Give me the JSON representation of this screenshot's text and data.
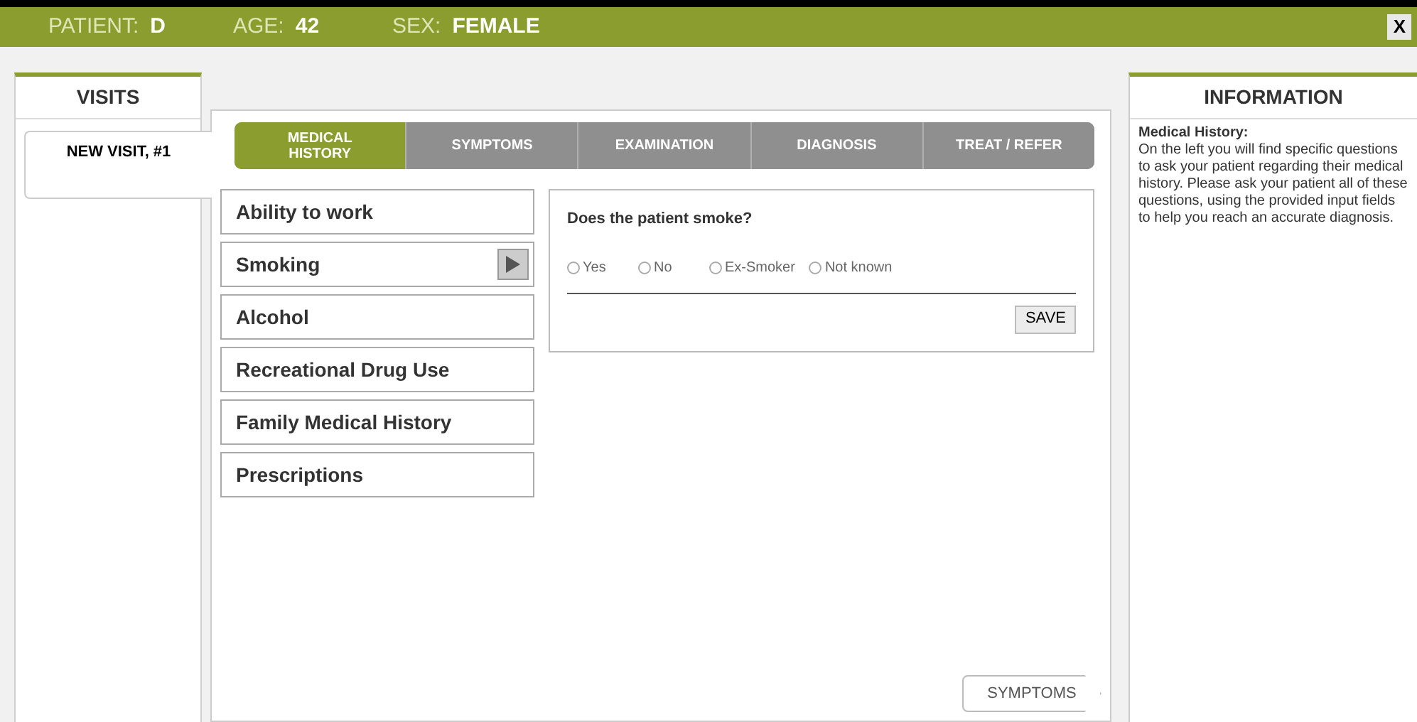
{
  "header": {
    "fields": [
      {
        "label": "PATIENT:",
        "value": "D"
      },
      {
        "label": "AGE:",
        "value": "42"
      },
      {
        "label": "SEX:",
        "value": "FEMALE"
      }
    ],
    "close": "X"
  },
  "visits": {
    "title": "VISITS",
    "items": [
      {
        "label": "NEW VISIT, #1",
        "selected": true
      }
    ]
  },
  "steps": [
    {
      "label": "MEDICAL HISTORY",
      "selected": true
    },
    {
      "label": "SYMPTOMS",
      "selected": false
    },
    {
      "label": "EXAMINATION",
      "selected": false
    },
    {
      "label": "DIAGNOSIS",
      "selected": false
    },
    {
      "label": "TREAT / REFER",
      "selected": false
    }
  ],
  "questions": [
    {
      "label": "Ability to work",
      "selected": false
    },
    {
      "label": "Smoking",
      "selected": true
    },
    {
      "label": "Alcohol",
      "selected": false
    },
    {
      "label": "Recreational Drug Use",
      "selected": false
    },
    {
      "label": "Family Medical History",
      "selected": false
    },
    {
      "label": "Prescriptions",
      "selected": false
    }
  ],
  "form": {
    "question": "Does the patient smoke?",
    "options": [
      {
        "label": "Yes",
        "selected": false
      },
      {
        "label": "No",
        "selected": false
      },
      {
        "label": "Ex-Smoker",
        "selected": false
      },
      {
        "label": "Not known",
        "selected": false
      }
    ],
    "save": "SAVE"
  },
  "next_button": "SYMPTOMS",
  "information": {
    "title": "INFORMATION",
    "heading": "Medical History:",
    "text": "On the left you will find specific questions to ask your patient regarding their medical history. Please ask your patient all of these questions, using the provided input fields to help you reach an accurate diagnosis."
  }
}
